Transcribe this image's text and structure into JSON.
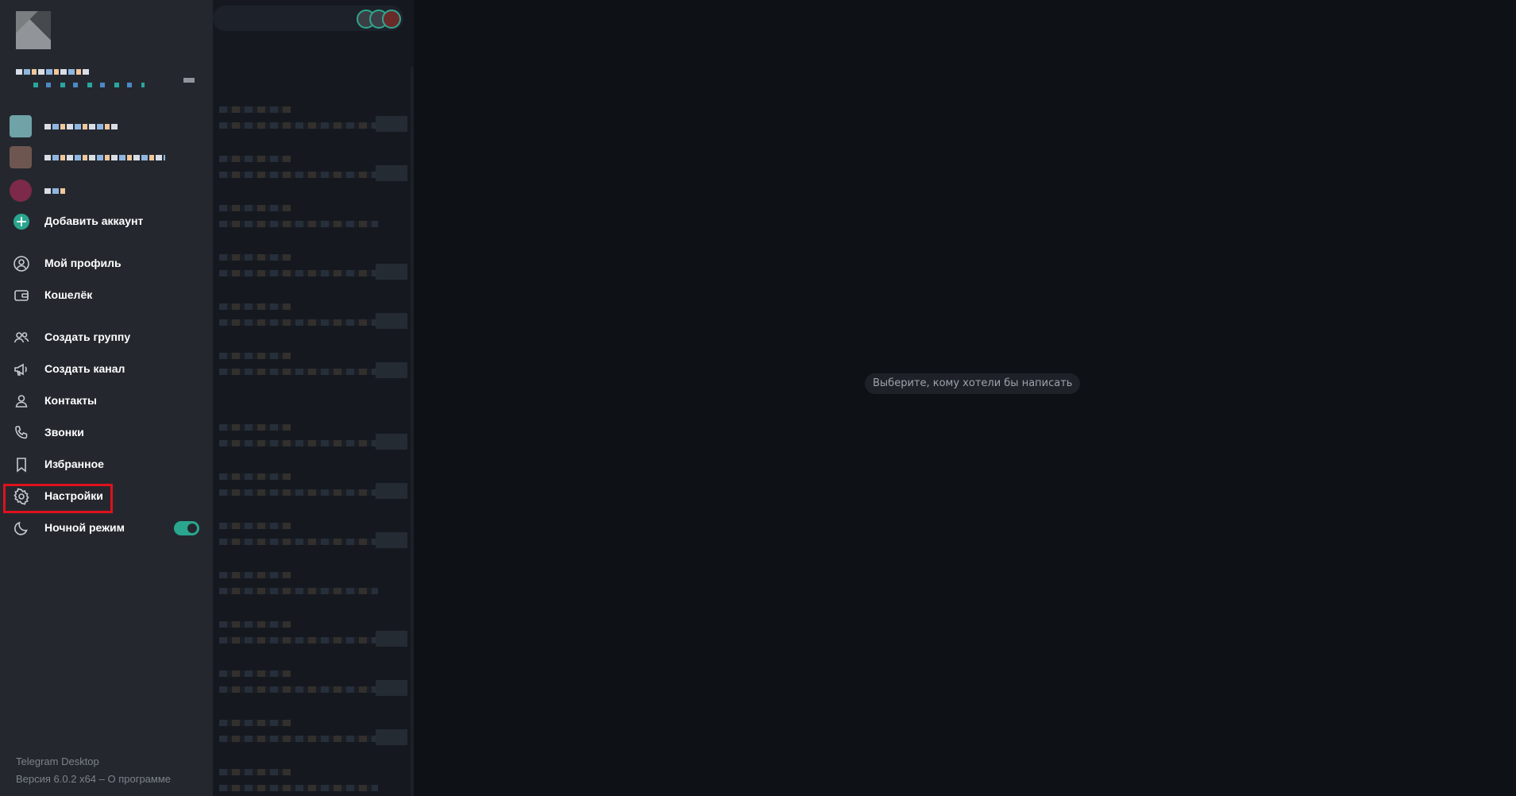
{
  "main": {
    "empty_hint": "Выберите, кому хотели бы написать"
  },
  "drawer": {
    "accounts": [
      {
        "avatar_color": "#6fa3a8"
      },
      {
        "avatar_color": "#6e5650"
      },
      {
        "avatar_color": "#7c2a47"
      }
    ],
    "add_account": {
      "label": "Добавить аккаунт",
      "icon": "plus-circle-icon",
      "color": "#2aa68f"
    },
    "menu": [
      {
        "id": "my-profile",
        "label": "Мой профиль",
        "icon": "user-circle-icon"
      },
      {
        "id": "wallet",
        "label": "Кошелёк",
        "icon": "wallet-icon"
      },
      {
        "id": "create-group",
        "label": "Создать группу",
        "icon": "users-icon"
      },
      {
        "id": "create-channel",
        "label": "Создать канал",
        "icon": "megaphone-icon"
      },
      {
        "id": "contacts",
        "label": "Контакты",
        "icon": "user-icon"
      },
      {
        "id": "calls",
        "label": "Звонки",
        "icon": "phone-icon"
      },
      {
        "id": "saved",
        "label": "Избранное",
        "icon": "bookmark-icon"
      },
      {
        "id": "settings",
        "label": "Настройки",
        "icon": "gear-icon"
      },
      {
        "id": "night-mode",
        "label": "Ночной режим",
        "icon": "moon-icon",
        "toggle_on": true
      }
    ],
    "footer": {
      "app_name": "Telegram Desktop",
      "version": "Версия 6.0.2 x64 – О программе"
    }
  },
  "colors": {
    "drawer_bg": "#24282e",
    "accent": "#2aa68f",
    "highlight": "#e0111d"
  }
}
